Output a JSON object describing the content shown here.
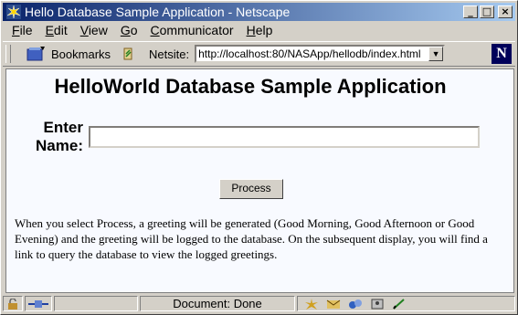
{
  "window": {
    "title": "Hello Database Sample Application - Netscape",
    "controls": [
      "_",
      "□",
      "×"
    ]
  },
  "menu": [
    {
      "label": "File",
      "key": "F"
    },
    {
      "label": "Edit",
      "key": "E"
    },
    {
      "label": "View",
      "key": "V"
    },
    {
      "label": "Go",
      "key": "G"
    },
    {
      "label": "Communicator",
      "key": "C"
    },
    {
      "label": "Help",
      "key": "H"
    }
  ],
  "menu_labels": {
    "file": "File",
    "edit": "Edit",
    "view": "View",
    "go": "Go",
    "communicator": "Communicator",
    "help": "Help"
  },
  "toolbar": {
    "bookmarks_label": "Bookmarks",
    "netsite_label": "Netsite:",
    "url": "http://localhost:80/NASApp/hellodb/index.html",
    "logo_letter": "N"
  },
  "page": {
    "title": "HelloWorld Database Sample Application",
    "enter_label": "Enter",
    "name_label": "Name:",
    "name_value": "",
    "process_label": "Process",
    "description": "When you select Process, a greeting will be generated (Good Morning, Good Afternoon or Good Evening) and the greeting will be logged to the database. On the subsequent display, you will find a link to query the database to view the logged greetings."
  },
  "status": {
    "text": "Document: Done"
  },
  "colors": {
    "title_start": "#0a246a",
    "title_end": "#a6caf0",
    "chrome": "#d4d0c8",
    "page_bg": "#f8faff"
  }
}
